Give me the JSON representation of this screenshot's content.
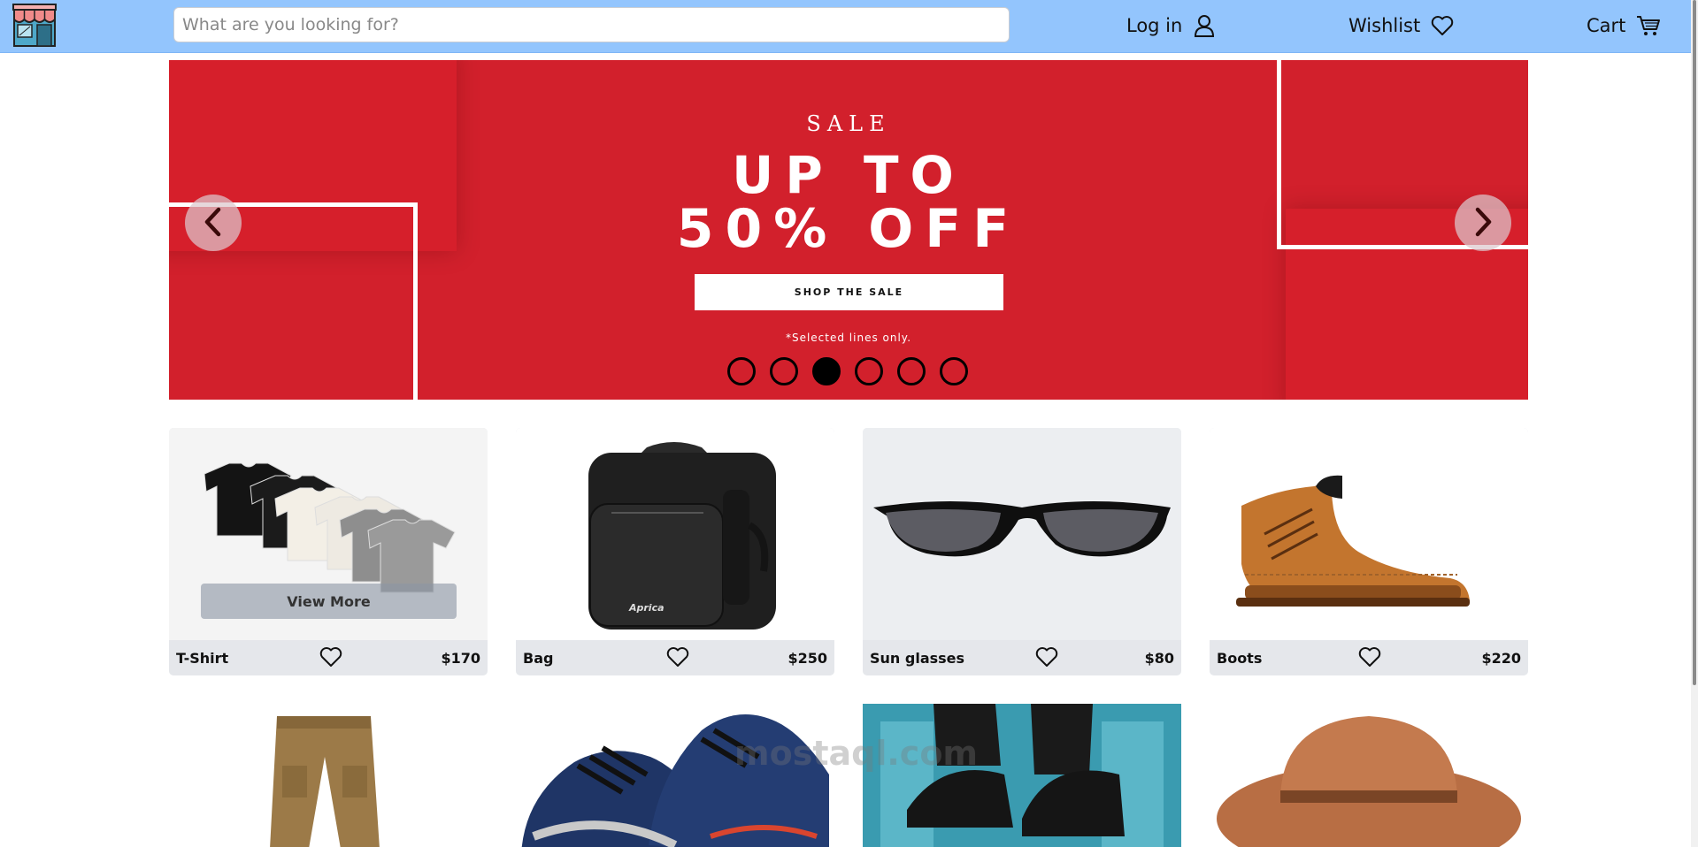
{
  "header": {
    "search_placeholder": "What are you looking for?",
    "login_label": "Log in",
    "wishlist_label": "Wishlist",
    "cart_label": "Cart",
    "logo_icon": "store-icon",
    "login_icon": "user-icon",
    "wishlist_icon": "heart-icon",
    "cart_icon": "cart-icon",
    "bg_color": "#93c5fd"
  },
  "hero": {
    "eyebrow": "SALE",
    "headline_1": "UP TO",
    "headline_2": "50% OFF",
    "cta_label": "SHOP THE SALE",
    "note": "*Selected lines only.",
    "bg_color": "#d2202c",
    "slide_count": 6,
    "active_slide": 3,
    "prev_icon": "chevron-left-icon",
    "next_icon": "chevron-right-icon"
  },
  "products": [
    {
      "name": "T-Shirt",
      "price": "$170",
      "icon": "heart-icon",
      "overlay_label": "View More"
    },
    {
      "name": "Bag",
      "price": "$250",
      "icon": "heart-icon"
    },
    {
      "name": "Sun glasses",
      "price": "$80",
      "icon": "heart-icon"
    },
    {
      "name": "Boots",
      "price": "$220",
      "icon": "heart-icon"
    }
  ],
  "products_row2": [
    {
      "image": "cargo-pants"
    },
    {
      "image": "running-sneakers"
    },
    {
      "image": "black-sneakers"
    },
    {
      "image": "fedora-hat"
    }
  ],
  "watermark": "mostaql.com"
}
